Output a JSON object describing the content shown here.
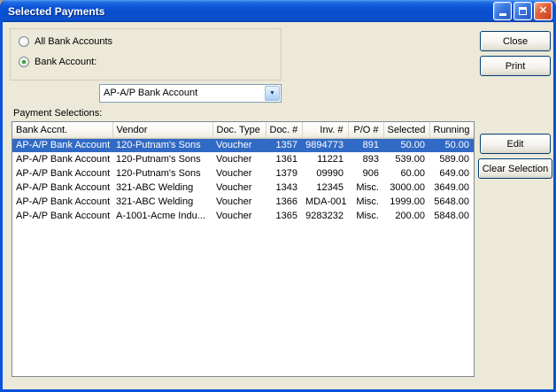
{
  "titlebar": {
    "title": "Selected Payments"
  },
  "icons": {
    "close_glyph": "✕",
    "combo_arrow_glyph": "▼"
  },
  "filters": {
    "all_accounts_label": "All Bank Accounts",
    "bank_account_label": "Bank Account:",
    "bank_account_value": "AP-A/P Bank Account",
    "selected": "bank_account"
  },
  "buttons": {
    "close": "Close",
    "print": "Print",
    "edit": "Edit",
    "clear_selection": "Clear Selection"
  },
  "table": {
    "label": "Payment Selections:",
    "columns": [
      "Bank Accnt.",
      "Vendor",
      "Doc. Type",
      "Doc. #",
      "Inv. #",
      "P/O #",
      "Selected",
      "Running"
    ],
    "right_aligned_from_column": 3,
    "selected_row_index": 0,
    "rows": [
      [
        "AP-A/P Bank Account",
        "120-Putnam's Sons",
        "Voucher",
        "1357",
        "9894773",
        "891",
        "50.00",
        "50.00"
      ],
      [
        "AP-A/P Bank Account",
        "120-Putnam's Sons",
        "Voucher",
        "1361",
        "11221",
        "893",
        "539.00",
        "589.00"
      ],
      [
        "AP-A/P Bank Account",
        "120-Putnam's Sons",
        "Voucher",
        "1379",
        "09990",
        "906",
        "60.00",
        "649.00"
      ],
      [
        "AP-A/P Bank Account",
        "321-ABC Welding",
        "Voucher",
        "1343",
        "12345",
        "Misc.",
        "3000.00",
        "3649.00"
      ],
      [
        "AP-A/P Bank Account",
        "321-ABC Welding",
        "Voucher",
        "1366",
        "MDA-001",
        "Misc.",
        "1999.00",
        "5648.00"
      ],
      [
        "AP-A/P Bank Account",
        "A-1001-Acme Indu...",
        "Voucher",
        "1365",
        "9283232",
        "Misc.",
        "200.00",
        "5848.00"
      ]
    ]
  },
  "colors": {
    "selection_bg": "#316AC5",
    "dialog_bg": "#ECE9D8",
    "titlebar_blue": "#0D56D8"
  }
}
